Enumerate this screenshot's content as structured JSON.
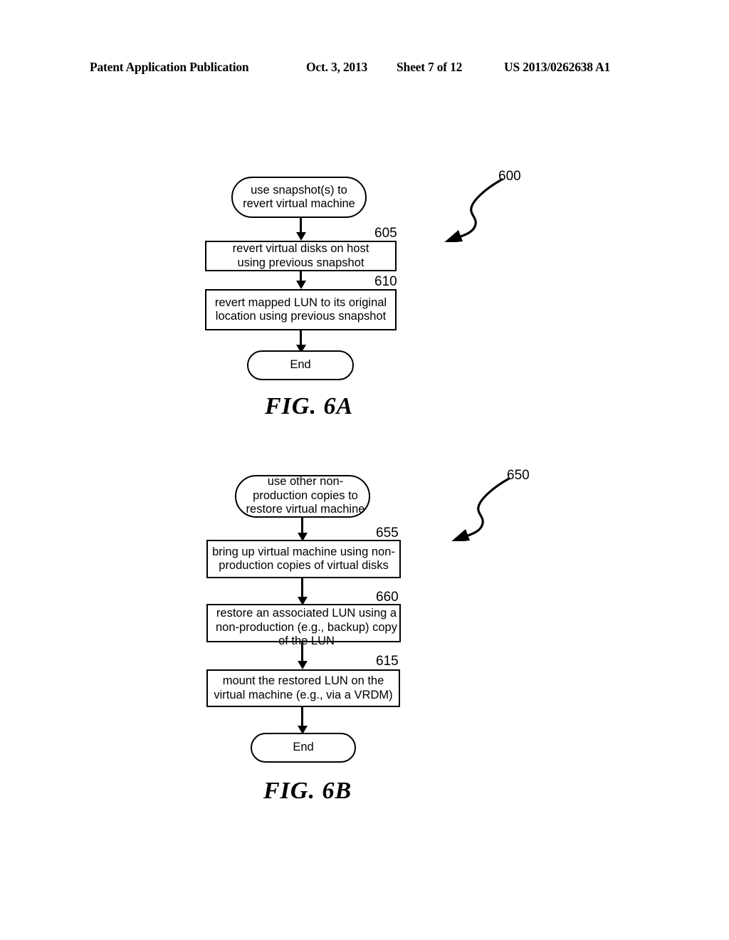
{
  "header": {
    "publication": "Patent Application Publication",
    "date": "Oct. 3, 2013",
    "sheet": "Sheet 7 of 12",
    "patent_number": "US 2013/0262638 A1"
  },
  "figures": [
    {
      "caption": "FIG. 6A",
      "reference_numeral": "600",
      "nodes": [
        {
          "id": "start-600",
          "shape": "terminal",
          "text": "use snapshot(s) to\nrevert virtual machine",
          "label": null
        },
        {
          "id": "step-605",
          "shape": "process",
          "text": "revert virtual disks on host\nusing previous snapshot",
          "label": "605"
        },
        {
          "id": "step-610",
          "shape": "process",
          "text": "revert mapped LUN to its original\nlocation using previous snapshot",
          "label": "610"
        },
        {
          "id": "end-6a",
          "shape": "terminal",
          "text": "End",
          "label": null
        }
      ]
    },
    {
      "caption": "FIG. 6B",
      "reference_numeral": "650",
      "nodes": [
        {
          "id": "start-650",
          "shape": "terminal",
          "text": "use other non-\nproduction copies to\nrestore virtual machine",
          "label": null
        },
        {
          "id": "step-655",
          "shape": "process",
          "text": "bring up virtual machine using non-\nproduction copies of virtual disks",
          "label": "655"
        },
        {
          "id": "step-660",
          "shape": "process",
          "text": "restore an associated LUN using a\nnon-production (e.g., backup) copy\nof the LUN",
          "label": "660"
        },
        {
          "id": "step-615",
          "shape": "process",
          "text": "mount the restored LUN on the\nvirtual machine (e.g., via a VRDM)",
          "label": "615"
        },
        {
          "id": "end-6b",
          "shape": "terminal",
          "text": "End",
          "label": null
        }
      ]
    }
  ],
  "colors": {
    "ink": "#000000",
    "paper": "#ffffff"
  }
}
